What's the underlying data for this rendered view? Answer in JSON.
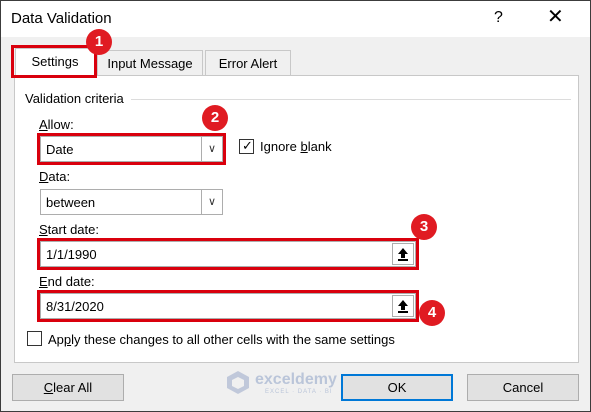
{
  "window": {
    "title": "Data Validation",
    "help": "?",
    "close": "✕"
  },
  "tabs": [
    {
      "label": "Settings",
      "selected": true
    },
    {
      "label": "Input Message",
      "selected": false
    },
    {
      "label": "Error Alert",
      "selected": false
    }
  ],
  "group_title": "Validation criteria",
  "allow": {
    "label_prefix": "",
    "label_u": "A",
    "label_rest": "llow:",
    "value": "Date"
  },
  "ignore_blank": {
    "label_prefix": "Ignore ",
    "label_u": "b",
    "label_rest": "lank",
    "checked": true
  },
  "data": {
    "label_u": "D",
    "label_rest": "ata:",
    "value": "between"
  },
  "start_date": {
    "label_u": "S",
    "label_rest": "tart date:",
    "value": "1/1/1990"
  },
  "end_date": {
    "label_u": "E",
    "label_rest": "nd date:",
    "value": "8/31/2020"
  },
  "apply_all": {
    "label_prefix": "Ap",
    "label_u": "p",
    "label_rest": "ly these changes to all other cells with the same settings",
    "checked": false
  },
  "buttons": {
    "clear_u": "C",
    "clear_rest": "lear All",
    "ok": "OK",
    "cancel": "Cancel"
  },
  "badges": [
    "1",
    "2",
    "3",
    "4"
  ],
  "watermark": {
    "name": "exceldemy",
    "sub": "EXCEL · DATA · BI"
  },
  "colors": {
    "highlight": "#d9000d",
    "badge": "#e01b22",
    "ok_border": "#0078d7"
  }
}
